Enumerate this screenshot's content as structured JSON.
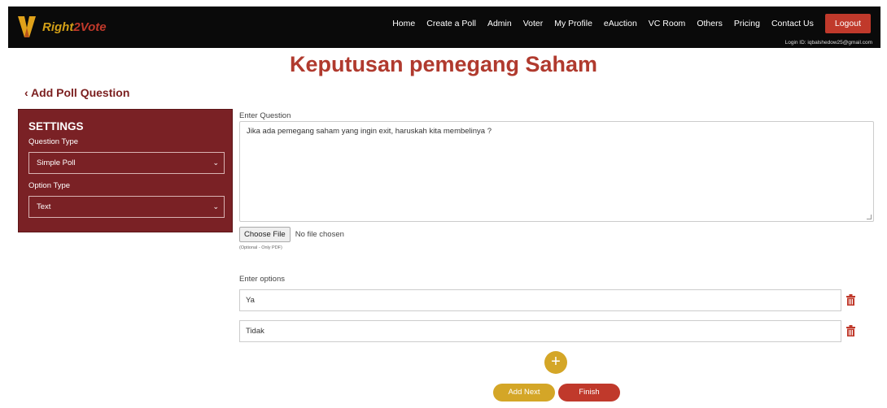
{
  "brand": {
    "logo_letter": "V",
    "name_part1": "Right",
    "name_part2": "2Vote"
  },
  "nav": {
    "items": [
      "Home",
      "Create a Poll",
      "Admin",
      "Voter",
      "My Profile",
      "eAuction",
      "VC Room",
      "Others",
      "Pricing",
      "Contact Us"
    ],
    "logout_label": "Logout",
    "login_id": "Login ID: iqbalshedow25@gmail.com"
  },
  "page": {
    "title": "Keputusan pemegang Saham",
    "back_label": "Add Poll Question"
  },
  "settings": {
    "title": "SETTINGS",
    "question_type_label": "Question Type",
    "question_type_value": "Simple Poll",
    "option_type_label": "Option Type",
    "option_type_value": "Text"
  },
  "question": {
    "label": "Enter Question",
    "value": "Jika ada pemegang saham yang ingin exit, haruskah kita membelinya ?"
  },
  "file": {
    "button_label": "Choose File",
    "status": "No file chosen",
    "hint": "(Optional - Only PDF)"
  },
  "options": {
    "label": "Enter options",
    "items": [
      "Ya",
      "Tidak"
    ]
  },
  "actions": {
    "add_symbol": "+",
    "add_next_label": "Add Next",
    "finish_label": "Finish"
  },
  "colors": {
    "accent_red": "#c0392b",
    "panel_maroon": "#7a2125",
    "gold": "#d4a627"
  },
  "icons": {
    "back": "chevron-left-icon",
    "select": "chevron-down-icon",
    "delete": "trash-icon",
    "add": "plus-icon"
  }
}
